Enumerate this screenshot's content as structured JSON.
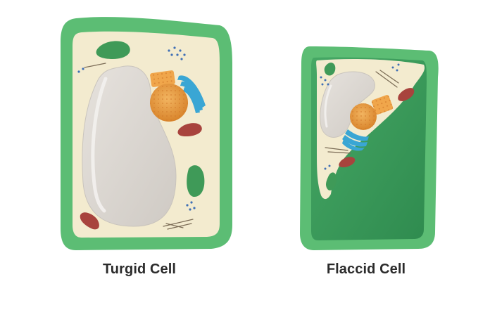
{
  "cells": [
    {
      "label": "Turgid Cell"
    },
    {
      "label": "Flaccid Cell"
    }
  ],
  "colors": {
    "cell_wall": "#5cbd74",
    "cell_wall_edge": "#4aa862",
    "cytoplasm": "#f3ebcf",
    "vacuole": "#dcd8d3",
    "nucleus": "#e79a3c",
    "chloroplast": "#3f9a58",
    "mitochondrion": "#a8433d",
    "golgi": "#3aa6d4",
    "er": "#f0a64b",
    "ribosome": "#3f6fb5",
    "shrunk_space": "#3d9e5c"
  }
}
